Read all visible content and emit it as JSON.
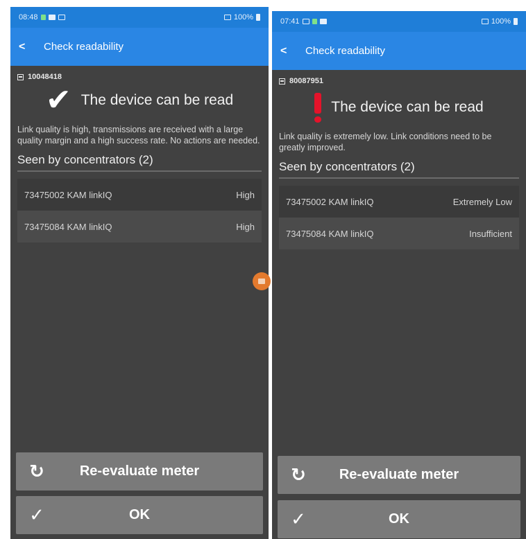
{
  "left": {
    "status_bar": {
      "time": "08:48",
      "battery": "100%"
    },
    "app_bar": {
      "back": "<",
      "title": "Check readability"
    },
    "meter_id": "10048418",
    "status_message": "The device can be read",
    "description": "Link quality is high, transmissions are received with a large quality margin and a high success rate. No actions are needed.",
    "section_title": "Seen by concentrators (2)",
    "concentrators": [
      {
        "name": "73475002  KAM  linkIQ",
        "value": "High"
      },
      {
        "name": "73475084  KAM  linkIQ",
        "value": "High"
      }
    ],
    "buttons": {
      "reevaluate": "Re-evaluate meter",
      "ok": "OK"
    }
  },
  "right": {
    "status_bar": {
      "time": "07:41",
      "battery": "100%"
    },
    "app_bar": {
      "back": "<",
      "title": "Check readability"
    },
    "meter_id": "80087951",
    "status_message": "The device can be read",
    "description": "Link quality is extremely low. Link conditions need to be greatly improved.",
    "section_title": "Seen by concentrators (2)",
    "concentrators": [
      {
        "name": "73475002  KAM  linkIQ",
        "value": "Extremely Low"
      },
      {
        "name": "73475084  KAM  linkIQ",
        "value": "Insufficient"
      }
    ],
    "buttons": {
      "reevaluate": "Re-evaluate meter",
      "ok": "OK"
    }
  },
  "icons": {
    "left_status": "check-icon",
    "right_status": "exclamation-icon",
    "reevaluate": "refresh-icon",
    "ok": "checkmark-icon"
  },
  "colors": {
    "app_bar": "#2a86e4",
    "background": "#414141",
    "button": "#7a7a7a",
    "warning": "#e4132a"
  }
}
